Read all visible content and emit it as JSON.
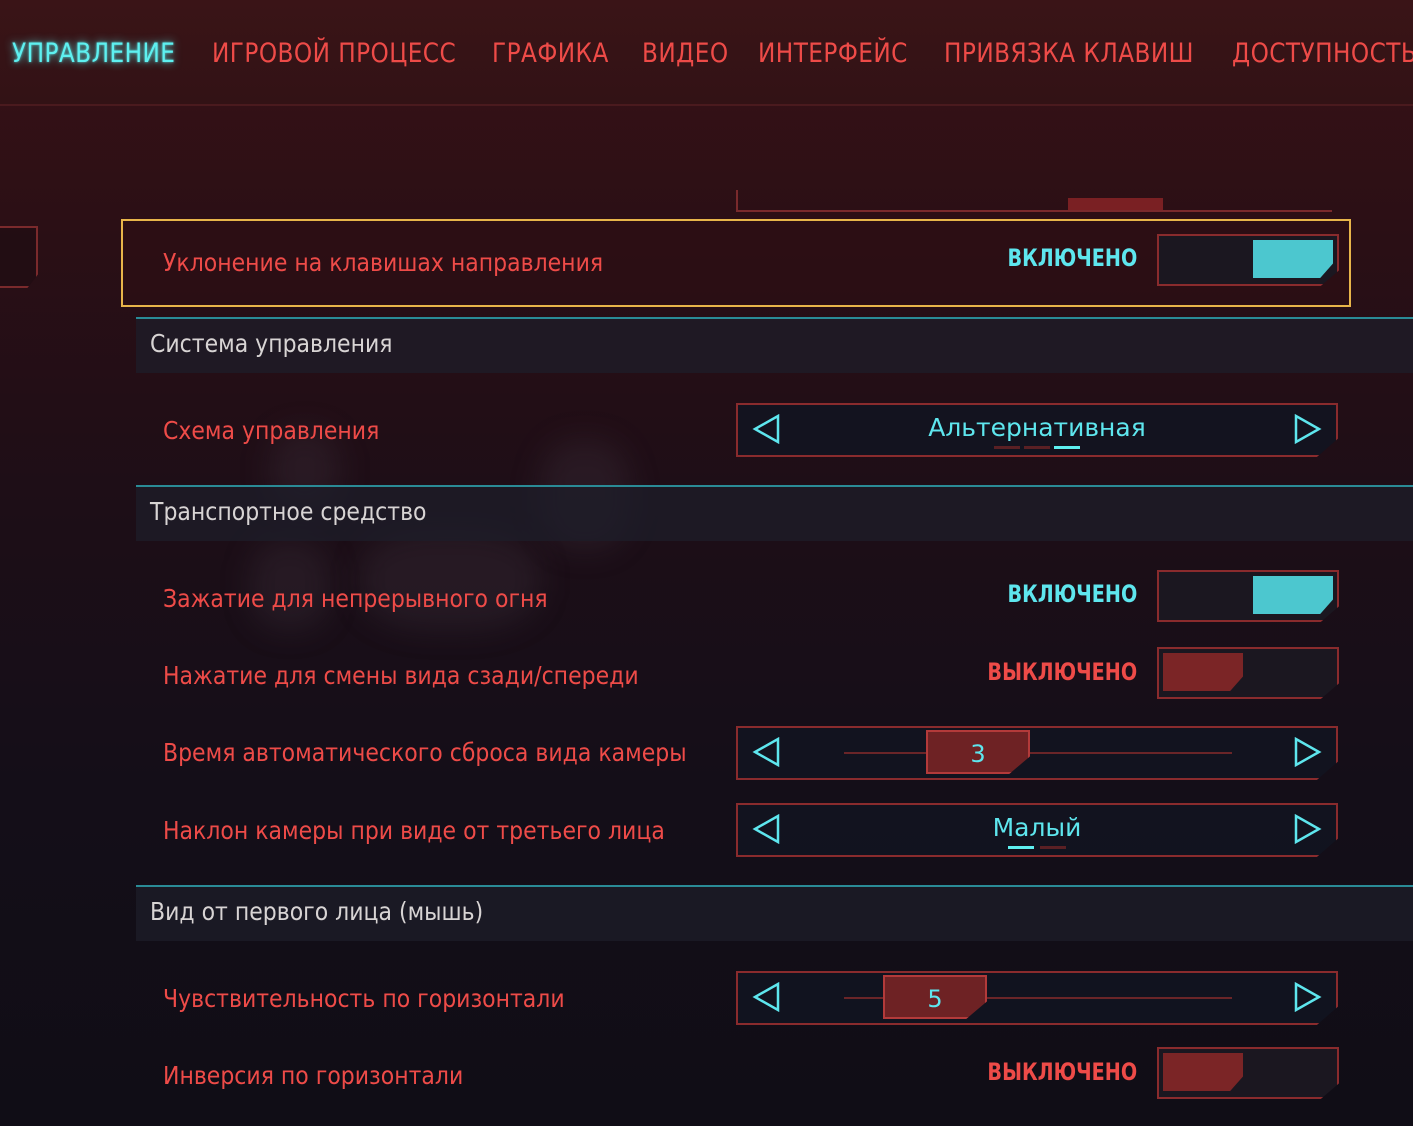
{
  "tabs": [
    {
      "label": "УПРАВЛЕНИЕ",
      "active": true
    },
    {
      "label": "ИГРОВОЙ ПРОЦЕСС",
      "active": false
    },
    {
      "label": "ГРАФИКА",
      "active": false
    },
    {
      "label": "ВИДЕО",
      "active": false
    },
    {
      "label": "ИНТЕРФЕЙС",
      "active": false
    },
    {
      "label": "ПРИВЯЗКА КЛАВИШ",
      "active": false
    },
    {
      "label": "ДОСТУПНОСТЬ",
      "active": false
    }
  ],
  "settings": {
    "dodge": {
      "label": "Уклонение на клавишах направления",
      "state": "ВКЛЮЧЕНО"
    },
    "control_system": {
      "title": "Система управления",
      "scheme": {
        "label": "Схема управления",
        "value": "Альтернативная",
        "option_count": 3,
        "selected_index": 2
      }
    },
    "vehicle": {
      "title": "Транспортное средство",
      "hold_fire": {
        "label": "Зажатие для непрерывного огня",
        "state": "ВКЛЮЧЕНО"
      },
      "press_view": {
        "label": "Нажатие для смены вида сзади/спереди",
        "state": "ВЫКЛЮЧЕНО"
      },
      "camera_reset": {
        "label": "Время автоматического сброса вида камеры",
        "value": "3"
      },
      "camera_tilt": {
        "label": "Наклон камеры при виде от третьего лица",
        "value": "Малый",
        "option_count": 2,
        "selected_index": 0
      }
    },
    "first_person": {
      "title": "Вид от первого лица (мышь)",
      "h_sensitivity": {
        "label": "Чувствительность по горизонтали",
        "value": "5"
      },
      "h_invert": {
        "label": "Инверсия по горизонтали",
        "state": "ВЫКЛЮЧЕНО"
      }
    }
  },
  "colors": {
    "accent_cyan": "#5ef0f0",
    "label_red": "#ee4b48",
    "focus_yellow": "#e8b54a",
    "toggle_on": "#4cc7cf",
    "toggle_off": "#7b2526"
  },
  "icons": {
    "prev": "triangle-left-icon",
    "next": "triangle-right-icon"
  }
}
